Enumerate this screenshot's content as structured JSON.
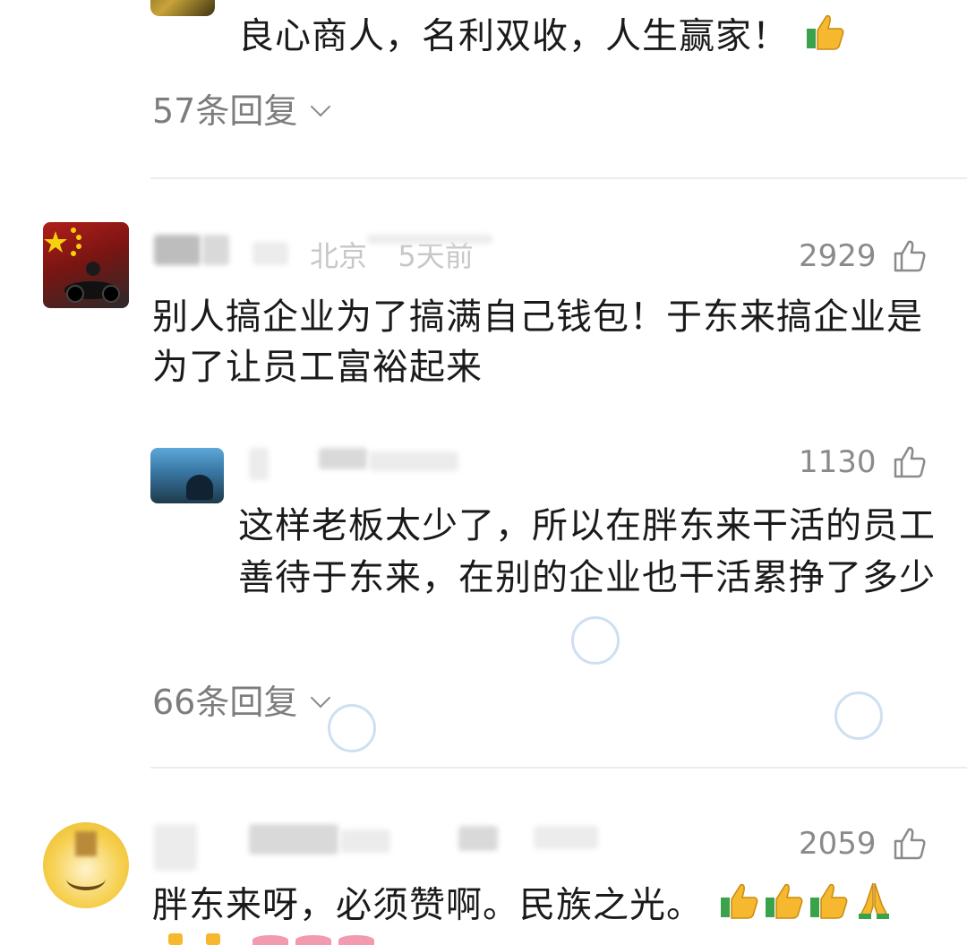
{
  "comment_top": {
    "text": "良心商人，名利双收，人生赢家！",
    "emoji": "thumbs-up",
    "replies_label": "57条回复"
  },
  "comment_1": {
    "username": "",
    "location": "北京",
    "time": "5天前",
    "likes": "2929",
    "text": "别人搞企业为了搞满自己钱包！于东来搞企业是为了让员工富裕起来",
    "reply": {
      "likes": "1130",
      "text": "这样老板太少了，所以在胖东来干活的员工善待于东来，在别的企业也干活累挣了多少"
    },
    "replies_label": "66条回复"
  },
  "comment_2": {
    "likes": "2059",
    "text": "胖东来呀，必须赞啊。民族之光。",
    "emojis": [
      "thumbs-up",
      "thumbs-up",
      "thumbs-up",
      "praying-hands"
    ]
  },
  "colors": {
    "text": "#1a1a1a",
    "meta": "#8a8a8a",
    "divider": "#ececec",
    "thumb_yellow": "#f5b82e",
    "thumb_green": "#3aa24a",
    "flag_red": "#d7261e"
  }
}
